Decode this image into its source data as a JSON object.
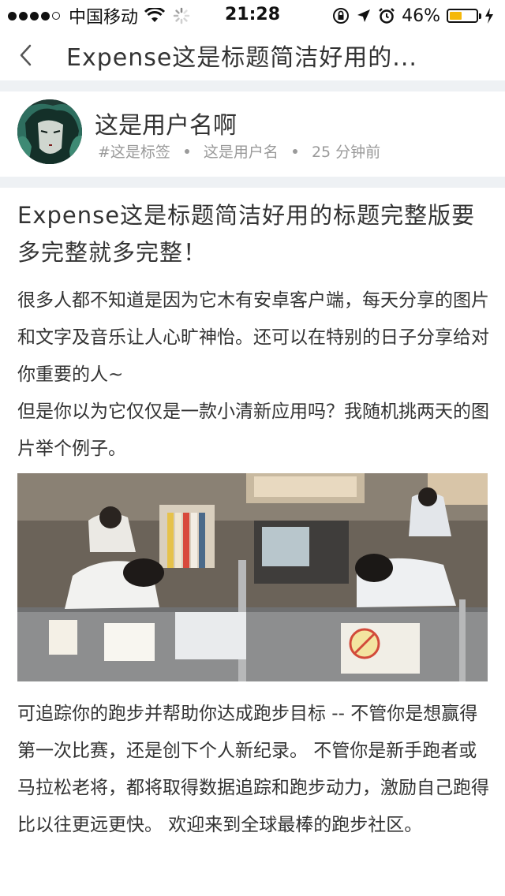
{
  "status_bar": {
    "carrier": "中国移动",
    "time": "21:28",
    "battery_percent_text": "46%",
    "battery_level": 0.46,
    "battery_color": "#f5b80a"
  },
  "nav": {
    "back_icon": "chevron-left-icon",
    "title": "Expense这是标题简洁好用的..."
  },
  "author": {
    "avatar_icon": "user-avatar",
    "username": "这是用户名啊",
    "tag": "#这是标签",
    "author_name": "这是用户名",
    "time_ago": "25 分钟前"
  },
  "article": {
    "title": "Expense这是标题简洁好用的标题完整版要多完整就多完整！",
    "paragraph_1_line_1": "很多人都不知道是因为它木有安卓客户端，每天分享的图片和文字及音乐让人心旷神怡。还可以在特别的日子分享给对你重要的人~",
    "paragraph_1_line_2": "但是你以为它仅仅是一款小清新应用吗？我随机挑两天的图片举个例子。",
    "image_icon": "office-workers-photo",
    "paragraph_2": "可追踪你的跑步并帮助你达成跑步目标 -- 不管你是想赢得第一次比赛，还是创下个人新纪录。 不管你是新手跑者或马拉松老将，都将取得数据追踪和跑步动力，激励自己跑得比以往更远更快。 欢迎来到全球最棒的跑步社区。"
  },
  "colors": {
    "divider": "#eef1f4",
    "meta_text": "#9a9a9a",
    "body_text": "#333333"
  }
}
